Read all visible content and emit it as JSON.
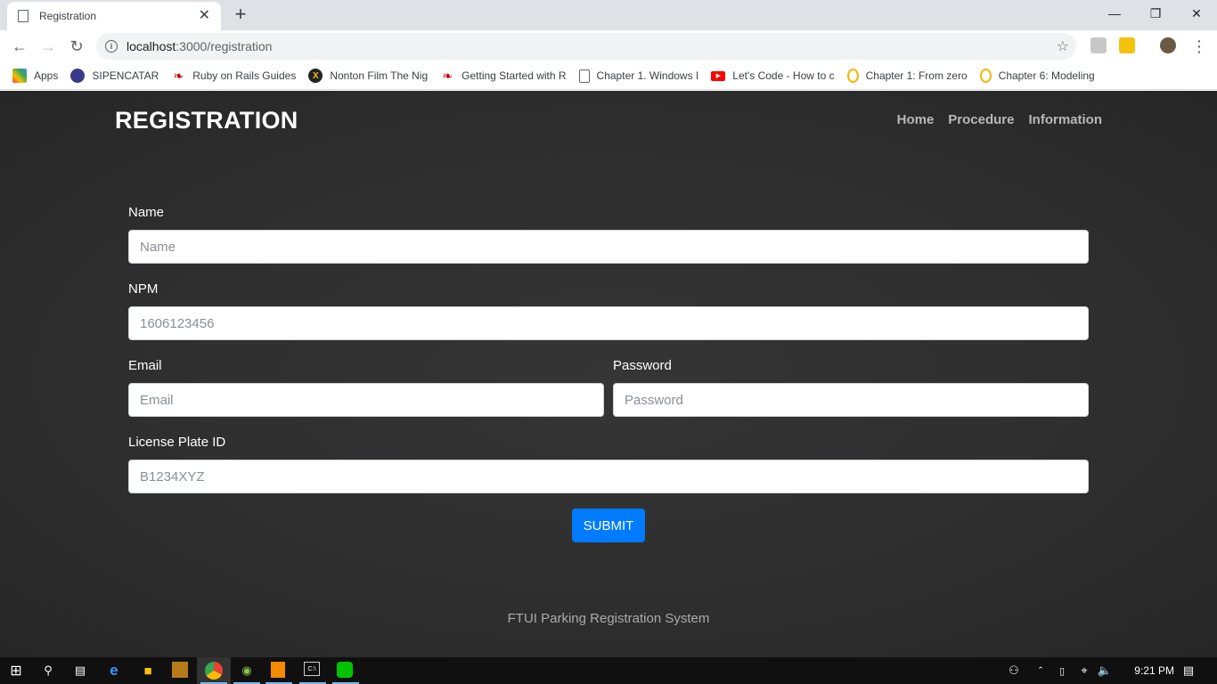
{
  "browser": {
    "tab_title": "Registration",
    "new_tab": "+",
    "close_tab": "✕",
    "url_host": "localhost",
    "url_rest": ":3000/registration",
    "window_controls": [
      "—",
      "❐",
      "✕"
    ]
  },
  "bookmarks": [
    {
      "label": "Apps",
      "icon": "apps-grid-icon"
    },
    {
      "label": "SIPENCATAR",
      "icon": "sipencatar-icon"
    },
    {
      "label": "Ruby on Rails Guides",
      "icon": "rails-icon"
    },
    {
      "label": "Nonton Film The Nig",
      "icon": "film-icon"
    },
    {
      "label": "Getting Started with R",
      "icon": "rails-icon"
    },
    {
      "label": "Chapter 1. Windows I",
      "icon": "page-icon"
    },
    {
      "label": "Let's Code - How to c",
      "icon": "youtube-icon"
    },
    {
      "label": "Chapter 1: From zero",
      "icon": "o-icon"
    },
    {
      "label": "Chapter 6: Modeling",
      "icon": "o-icon"
    }
  ],
  "header": {
    "brand": "REGISTRATION",
    "nav": [
      "Home",
      "Procedure",
      "Information"
    ]
  },
  "form": {
    "name_label": "Name",
    "name_placeholder": "Name",
    "npm_label": "NPM",
    "npm_placeholder": "1606123456",
    "email_label": "Email",
    "email_placeholder": "Email",
    "password_label": "Password",
    "password_placeholder": "Password",
    "plate_label": "License Plate ID",
    "plate_placeholder": "B1234XYZ",
    "submit": "SUBMIT"
  },
  "footer": "FTUI Parking Registration System",
  "taskbar": {
    "clock": "9:21 PM"
  },
  "colors": {
    "accent": "#007bff",
    "page_bg": "#2e2e2e"
  }
}
